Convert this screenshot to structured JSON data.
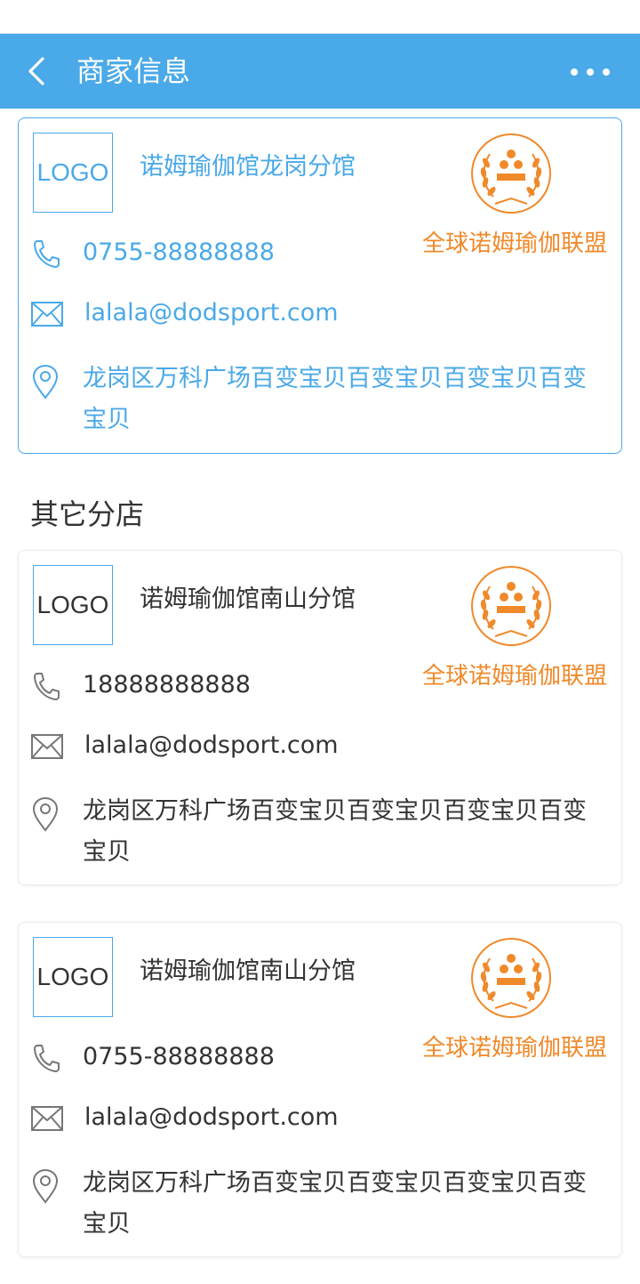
{
  "nav": {
    "title": "商家信息"
  },
  "primary_store": {
    "logo": "LOGO",
    "name": "诺姆瑜伽馆龙岗分馆",
    "alliance": "全球诺姆瑜伽联盟",
    "phone": "0755-88888888",
    "email": "lalala@dodsport.com",
    "address": "龙岗区万科广场百变宝贝百变宝贝百变宝贝百变宝贝"
  },
  "section_title": "其它分店",
  "other_stores": [
    {
      "logo": "LOGO",
      "name": "诺姆瑜伽馆南山分馆",
      "alliance": "全球诺姆瑜伽联盟",
      "phone": "18888888888",
      "email": "lalala@dodsport.com",
      "address": "龙岗区万科广场百变宝贝百变宝贝百变宝贝百变宝贝"
    },
    {
      "logo": "LOGO",
      "name": "诺姆瑜伽馆南山分馆",
      "alliance": "全球诺姆瑜伽联盟",
      "phone": "0755-88888888",
      "email": "lalala@dodsport.com",
      "address": "龙岗区万科广场百变宝贝百变宝贝百变宝贝百变宝贝"
    }
  ],
  "icons": {
    "back": "chevron-left-icon",
    "more": "more-dots-icon",
    "phone": "phone-icon",
    "email": "envelope-icon",
    "address": "location-pin-icon",
    "badge": "laurel-badge-icon"
  },
  "colors": {
    "nav_bg": "#4aa9e8",
    "primary_text": "#4aa9e8",
    "alliance": "#f0892a",
    "body_text": "#333333",
    "icon_gray": "#777777"
  }
}
